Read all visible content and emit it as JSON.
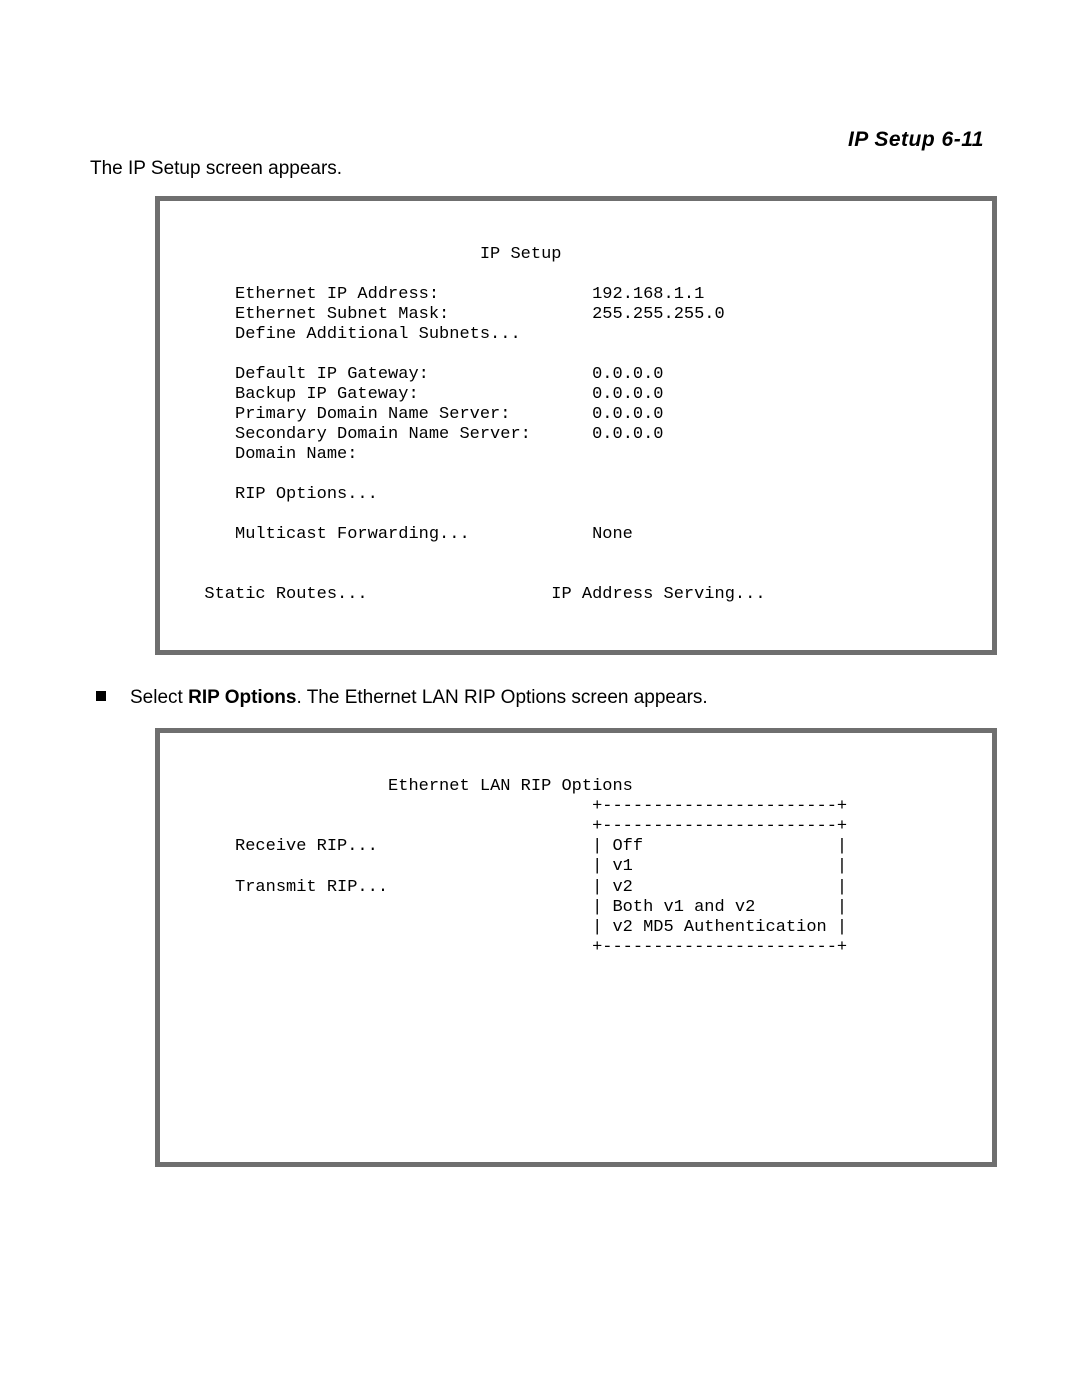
{
  "header": {
    "title": "IP Setup   6-11"
  },
  "intro": "The IP Setup screen appears.",
  "ipsetup": {
    "title": "IP Setup",
    "labels": {
      "eth_ip": "Ethernet IP Address:",
      "eth_mask": "Ethernet Subnet Mask:",
      "def_subnets": "Define Additional Subnets...",
      "def_gw": "Default IP Gateway:",
      "bak_gw": "Backup IP Gateway:",
      "pri_dns": "Primary Domain Name Server:",
      "sec_dns": "Secondary Domain Name Server:",
      "dom": "Domain Name:",
      "rip": "RIP Options...",
      "mcast": "Multicast Forwarding...",
      "static_routes": "Static Routes...",
      "addr_serving": "IP Address Serving..."
    },
    "values": {
      "eth_ip": "192.168.1.1",
      "eth_mask": "255.255.255.0",
      "def_gw": "0.0.0.0",
      "bak_gw": "0.0.0.0",
      "pri_dns": "0.0.0.0",
      "sec_dns": "0.0.0.0",
      "mcast": "None"
    }
  },
  "instruction": {
    "prefix": "Select ",
    "bold": "RIP Options",
    "suffix": ". The Ethernet LAN RIP Options screen appears."
  },
  "rip": {
    "title": "Ethernet LAN RIP Options",
    "labels": {
      "receive": "Receive RIP...",
      "transmit": "Transmit RIP..."
    },
    "options": {
      "opt0": "Off",
      "opt1": "v1",
      "opt2": "v2",
      "opt3": "Both v1 and v2",
      "opt4": "v2 MD5 Authentication"
    }
  }
}
